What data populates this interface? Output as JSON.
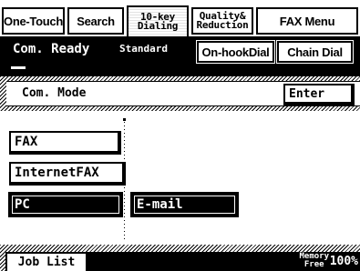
{
  "tabs": [
    {
      "label": "One-Touch"
    },
    {
      "label": "Search"
    },
    {
      "line1": "10-key",
      "line2": "Dialing",
      "active": true
    },
    {
      "line1": "Quality&",
      "line2": "Reduction"
    },
    {
      "label": "FAX Menu"
    }
  ],
  "status": {
    "text": "Com. Ready",
    "mode": "Standard",
    "onhook_label": "On-hookDial",
    "chain_label": "Chain Dial"
  },
  "com_mode": {
    "label": "Com. Mode",
    "enter_label": "Enter"
  },
  "modes": {
    "fax": "FAX",
    "internet_fax": "InternetFAX",
    "pc": "PC",
    "email": "E-mail"
  },
  "footer": {
    "job_list_label": "Job List",
    "memory_line1": "Memory",
    "memory_line2": "Free",
    "memory_value": "100%"
  },
  "colors": {
    "foreground": "#000000",
    "background": "#ffffff"
  }
}
